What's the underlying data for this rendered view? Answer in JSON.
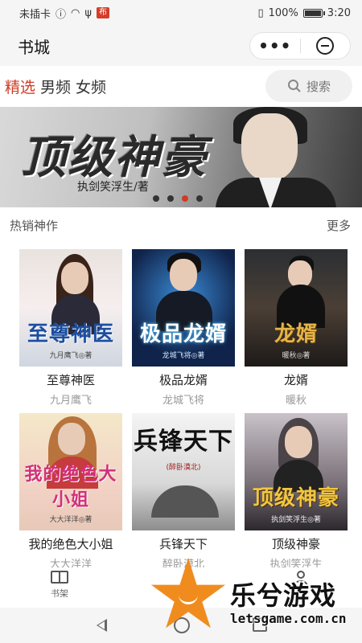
{
  "status_bar": {
    "carrier": "未插卡",
    "tag": "布",
    "battery": "100%",
    "battery_level": 1.0,
    "time": "3:20"
  },
  "app_bar": {
    "title": "书城",
    "more_label": "•••"
  },
  "tabs": [
    {
      "label": "精选",
      "active": true
    },
    {
      "label": "男频",
      "active": false
    },
    {
      "label": "女频",
      "active": false
    }
  ],
  "search": {
    "label": "搜索",
    "icon": "search-icon"
  },
  "banner": {
    "title": "顶级神豪",
    "author_line": "执剑笑浮生/著",
    "slide_count": 4,
    "active_slide": 3
  },
  "section": {
    "title": "热销神作",
    "more_label": "更多"
  },
  "books": [
    {
      "title": "至尊神医",
      "author": "九月鹰飞",
      "cover_title": "至尊神医",
      "cover_sub": "九月鹰飞◎著"
    },
    {
      "title": "极品龙婿",
      "author": "龙城飞将",
      "cover_title": "极品龙婿",
      "cover_sub": "龙城飞将◎著"
    },
    {
      "title": "龙婿",
      "author": "暖秋",
      "cover_title": "龙婿",
      "cover_sub": "暖秋◎著"
    },
    {
      "title": "我的绝色大小姐",
      "author": "大大洋洋",
      "cover_title": "我的绝色大小姐",
      "cover_sub": "大大洋洋◎著"
    },
    {
      "title": "兵锋天下",
      "author": "醉卧漠北",
      "cover_title": "兵锋天下",
      "cover_sub": "(醉卧漠北)"
    },
    {
      "title": "顶级神豪",
      "author": "执剑笑浮生",
      "cover_title": "顶级神豪",
      "cover_sub": "执剑笑浮生◎著"
    }
  ],
  "bottom_tabs": [
    {
      "label": "书架",
      "icon": "book-icon"
    },
    {
      "label": "",
      "icon": "person-icon"
    }
  ],
  "watermark": {
    "title": "乐兮游戏",
    "url": "letsgame.com.cn",
    "color": "#f08c1e"
  },
  "colors": {
    "accent": "#d13a25"
  }
}
